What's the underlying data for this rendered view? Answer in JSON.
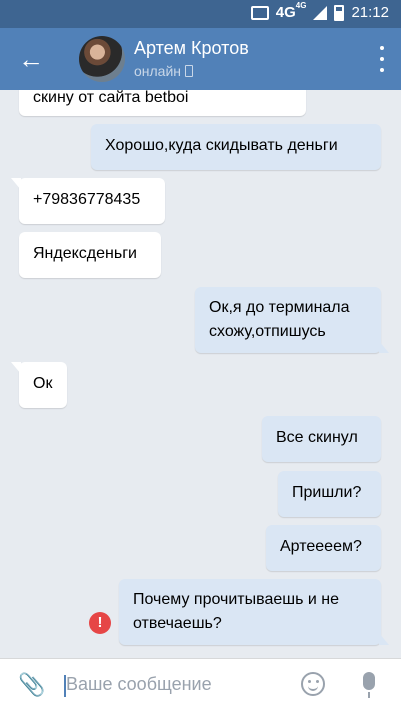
{
  "status_bar": {
    "network": "4G",
    "network_sup": "4G",
    "time": "21:12"
  },
  "header": {
    "contact_name": "Артем Кротов",
    "presence": "онлайн"
  },
  "messages": [
    {
      "direction": "in",
      "text": "скину  от сайта betboi"
    },
    {
      "direction": "out",
      "text": "Хорошо,куда скидывать деньги"
    },
    {
      "direction": "in",
      "text": "+79836778435"
    },
    {
      "direction": "in",
      "text": "Яндексденьги"
    },
    {
      "direction": "out",
      "text": "Ок,я до терминала схожу,отпишусь"
    },
    {
      "direction": "in",
      "text": "Ок"
    },
    {
      "direction": "out",
      "text": "Все скинул"
    },
    {
      "direction": "out",
      "text": "Пришли?"
    },
    {
      "direction": "out",
      "text": "Артеееем?"
    },
    {
      "direction": "out",
      "text": "Почему прочитываешь и не отвечаешь?",
      "error": "!"
    }
  ],
  "composer": {
    "placeholder": "Ваше сообщение"
  },
  "colors": {
    "header": "#5181b8",
    "status_bar": "#3e6591",
    "background": "#e7ebf0",
    "outgoing": "#dae6f4",
    "incoming": "#ffffff",
    "error": "#e64646"
  }
}
